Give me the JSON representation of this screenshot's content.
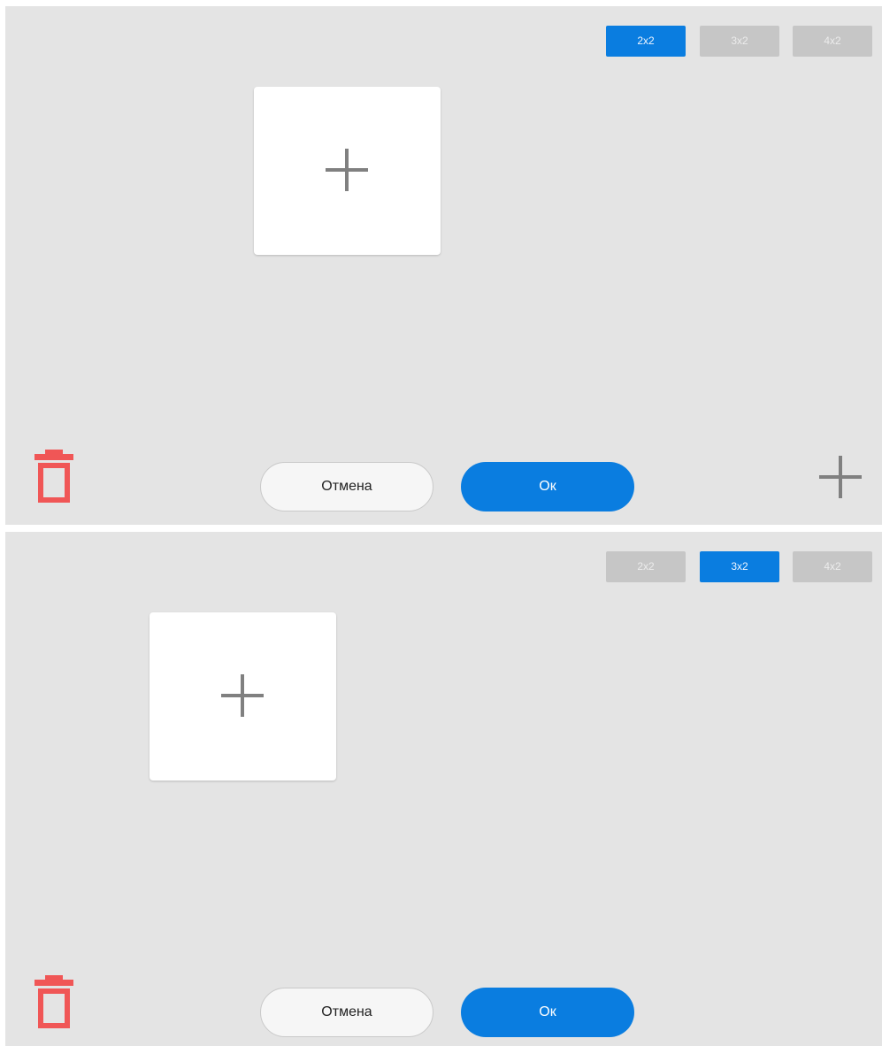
{
  "colors": {
    "panel_background": "#e4e4e4",
    "accent": "#0a7de0",
    "inactive_tab": "#c6c6c6",
    "delete_icon": "#f05656",
    "plus_icon": "#808080"
  },
  "panels": [
    {
      "layout_tabs": [
        {
          "label": "2x2",
          "active": true
        },
        {
          "label": "3x2",
          "active": false
        },
        {
          "label": "4x2",
          "active": false
        }
      ],
      "add_tile_icon": "plus-icon",
      "delete_icon": "trash-icon",
      "cancel_label": "Отмена",
      "ok_label": "Ок",
      "add_widget_icon": "plus-icon"
    },
    {
      "layout_tabs": [
        {
          "label": "2x2",
          "active": false
        },
        {
          "label": "3x2",
          "active": true
        },
        {
          "label": "4x2",
          "active": false
        }
      ],
      "add_tile_icon": "plus-icon",
      "delete_icon": "trash-icon",
      "cancel_label": "Отмена",
      "ok_label": "Ок"
    }
  ]
}
